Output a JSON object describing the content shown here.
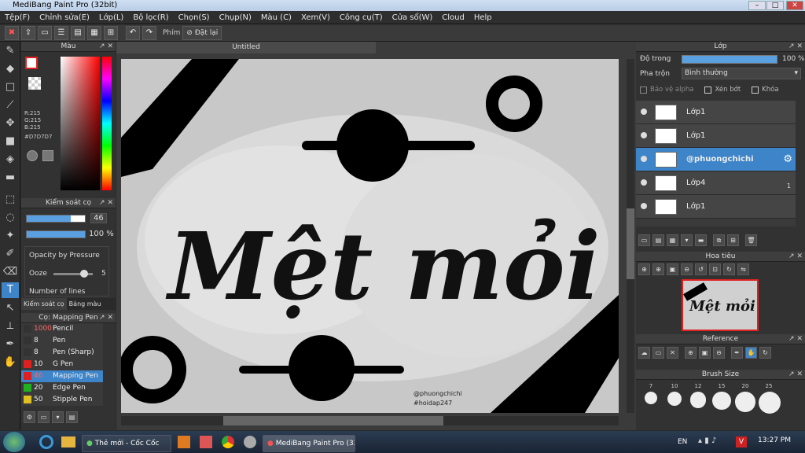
{
  "window": {
    "title": "MediBang Paint Pro (32bit)"
  },
  "menu": [
    "Tệp(F)",
    "Chỉnh sửa(E)",
    "Lớp(L)",
    "Bộ lọc(R)",
    "Chọn(S)",
    "Chụp(N)",
    "Màu (C)",
    "Xem(V)",
    "Công cụ(T)",
    "Cửa sổ(W)",
    "Cloud",
    "Help"
  ],
  "toolbar": {
    "key_label": "Phím",
    "reset_label": "Đặt lại"
  },
  "color_panel": {
    "title": "Màu",
    "r": "R:215",
    "g": "G:215",
    "b": "B:215",
    "hex": "#D7D7D7",
    "current": "#d7d7d7"
  },
  "brush_control": {
    "title": "Kiểm soát cọ",
    "size": "46",
    "opacity": "100 %",
    "opacity_by_pressure": "Opacity by Pressure",
    "ooze": "Ooze",
    "ooze_value": "5",
    "number_of_lines": "Number of lines",
    "tab1": "Kiểm soát cọ",
    "tab2": "Bảng màu"
  },
  "brush_list": {
    "title": "Cọ: Mapping Pen",
    "items": [
      {
        "size": "1000",
        "name": "Pencil",
        "color": "#333333"
      },
      {
        "size": "8",
        "name": "Pen",
        "color": "#333333"
      },
      {
        "size": "8",
        "name": "Pen (Sharp)",
        "color": "#333333"
      },
      {
        "size": "10",
        "name": "G Pen",
        "color": "#e02020"
      },
      {
        "size": "46",
        "name": "Mapping Pen",
        "color": "#e02020",
        "selected": true
      },
      {
        "size": "20",
        "name": "Edge Pen",
        "color": "#20b020"
      },
      {
        "size": "50",
        "name": "Stipple Pen",
        "color": "#e0c020"
      }
    ]
  },
  "canvas": {
    "tab": "Untitled",
    "text_main": "Mệt mỏi",
    "credit1": "@phuongchichi",
    "credit2": "#hoidap247"
  },
  "layers_panel": {
    "title": "Lớp",
    "opacity_label": "Độ trong",
    "opacity_value": "100 %",
    "blend_label": "Pha trộn",
    "blend_value": "Bình thường",
    "protect_alpha": "Bảo vệ alpha",
    "clipping": "Xén bớt",
    "lock": "Khóa",
    "layers": [
      {
        "name": "Lớp1"
      },
      {
        "name": "Lớp1"
      },
      {
        "name": "@phuongchichi",
        "selected": true
      },
      {
        "name": "Lớp4",
        "badge": "1"
      },
      {
        "name": "Lớp1"
      }
    ]
  },
  "navigator": {
    "title": "Hoa tiêu",
    "thumb_text": "Mệt mỏi"
  },
  "reference": {
    "title": "Reference"
  },
  "brush_size": {
    "title": "Brush Size",
    "sizes": [
      "7",
      "10",
      "12",
      "15",
      "20",
      "25"
    ]
  },
  "taskbar": {
    "app1": "Thẻ mới - Cốc Cốc",
    "app2": "MediBang Paint Pro (32...",
    "lang": "EN",
    "time": "13:27 PM"
  }
}
